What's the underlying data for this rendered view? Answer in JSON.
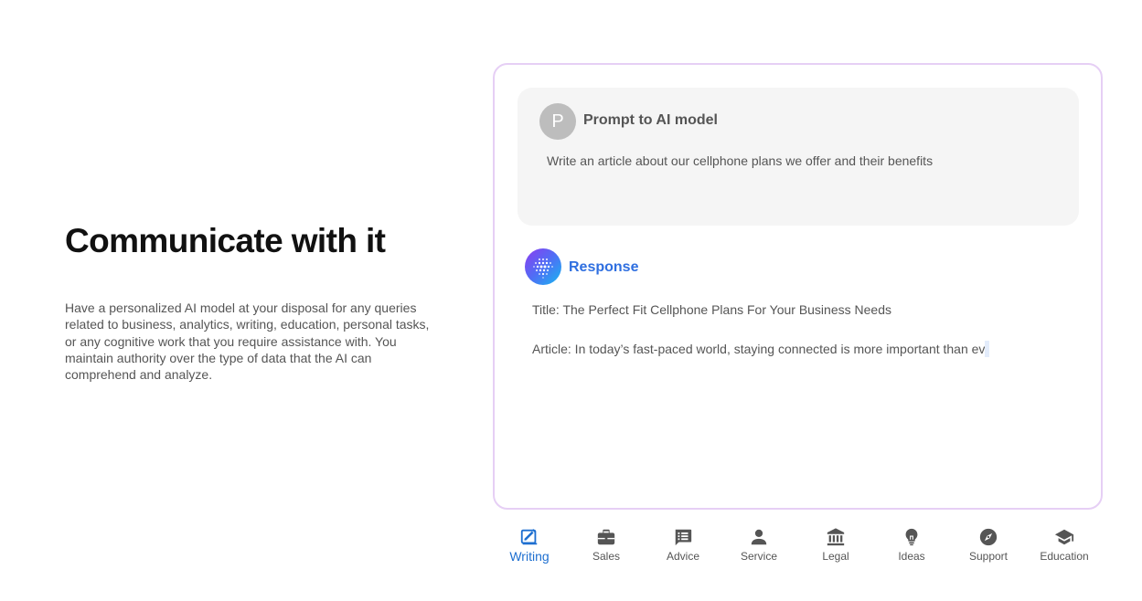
{
  "hero": {
    "headline": "Communicate with it",
    "description": "Have a personalized AI model at your disposal for any queries related to business, analytics, writing, education, personal tasks, or any cognitive work that you require assistance with. You maintain authority over the type of data that the AI can comprehend and analyze."
  },
  "prompt": {
    "avatar_letter": "P",
    "title": "Prompt to AI model",
    "text": "Write an article about our cellphone plans we offer and their benefits"
  },
  "response": {
    "title": "Response",
    "line_title": "Title: The Perfect Fit Cellphone Plans For Your Business Needs",
    "line_article": "Article: In today’s fast-paced world, staying connected is more important than ev"
  },
  "tabs": [
    {
      "label": "Writing",
      "icon": "writing-icon",
      "active": true
    },
    {
      "label": "Sales",
      "icon": "briefcase-icon",
      "active": false
    },
    {
      "label": "Advice",
      "icon": "chat-list-icon",
      "active": false
    },
    {
      "label": "Service",
      "icon": "person-icon",
      "active": false
    },
    {
      "label": "Legal",
      "icon": "bank-icon",
      "active": false
    },
    {
      "label": "Ideas",
      "icon": "lightbulb-icon",
      "active": false
    },
    {
      "label": "Support",
      "icon": "compass-icon",
      "active": false
    },
    {
      "label": "Education",
      "icon": "graduation-cap-icon",
      "active": false
    }
  ],
  "colors": {
    "accent": "#1e6fd0",
    "response_title": "#2f6fe0",
    "card_border": "#e6cff5",
    "prompt_bg": "#f5f5f5",
    "icon_gray": "#555555"
  }
}
